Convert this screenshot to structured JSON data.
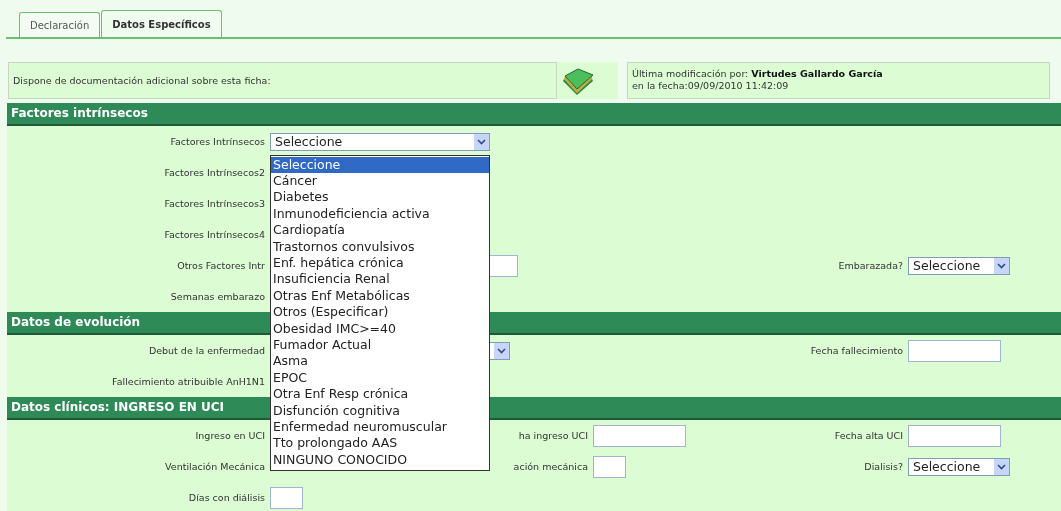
{
  "tabs": [
    {
      "label": "Declaración",
      "selected": false
    },
    {
      "label": "Datos Específicos",
      "selected": true
    }
  ],
  "info": {
    "documentation_label": "Dispone de documentación adicional sobre esta ficha:",
    "modified_by": "Última modificación por: **Virtudes Gallardo García**",
    "modified_date": "en la fecha:09/09/2010 11:42:09"
  },
  "sections": [
    {
      "title": "Factores intrínsecos",
      "rows": [
        {
          "left": {
            "label": "Factores Intrínsecos",
            "kind": "open-select",
            "value": "Seleccione",
            "options": [
              {
                "label": "Seleccione",
                "selected": true
              },
              {
                "label": "Cáncer",
                "selected": false
              },
              {
                "label": "Diabetes",
                "selected": false
              },
              {
                "label": "Inmunodeficiencia activa",
                "selected": false
              },
              {
                "label": "Cardiopatía",
                "selected": false
              },
              {
                "label": "Trastornos convulsivos",
                "selected": false
              },
              {
                "label": "Enf. hepática crónica",
                "selected": false
              },
              {
                "label": "Insuficiencia Renal",
                "selected": false
              },
              {
                "label": "Otras Enf Metabólicas",
                "selected": false
              },
              {
                "label": "Otros (Especificar)",
                "selected": false
              },
              {
                "label": "Obesidad IMC>=40",
                "selected": false
              },
              {
                "label": "Fumador Actual",
                "selected": false
              },
              {
                "label": "Asma",
                "selected": false
              },
              {
                "label": "EPOC",
                "selected": false
              },
              {
                "label": "Otra Enf Resp crónica",
                "selected": false
              },
              {
                "label": "Disfunción cognitiva",
                "selected": false
              },
              {
                "label": "Enfermedad neuromuscular",
                "selected": false
              },
              {
                "label": "Tto prolongado AAS",
                "selected": false
              },
              {
                "label": "NINGUNO CONOCIDO",
                "selected": false
              }
            ]
          }
        },
        {
          "left": {
            "label": "Factores Intrínsecos2",
            "kind": "label"
          }
        },
        {
          "left": {
            "label": "Factores Intrínsecos3",
            "kind": "label"
          }
        },
        {
          "left": {
            "label": "Factores Intrínsecos4",
            "kind": "label"
          }
        },
        {
          "left": {
            "label": "Otros Factores Intr",
            "kind": "text"
          },
          "right": {
            "label": "Embarazada?",
            "kind": "select",
            "value": "Seleccione"
          }
        },
        {
          "left": {
            "label": "Semanas embarazo",
            "kind": "label"
          }
        }
      ]
    },
    {
      "title": "Datos de evolución",
      "rows": [
        {
          "left": {
            "label": "Debut de la enfermedad",
            "kind": "select"
          },
          "right": {
            "label": "Fecha fallecimiento",
            "kind": "text"
          }
        },
        {
          "left": {
            "label": "Fallecimiento atribuible AnH1N1",
            "kind": "label"
          }
        }
      ]
    },
    {
      "title": "Datos clínicos: INGRESO EN UCI",
      "rows": [
        {
          "left": {
            "label": "Ingreso en UCI",
            "kind": "label"
          },
          "middle": {
            "label": "ha ingreso UCI",
            "kind": "text"
          },
          "right": {
            "label": "Fecha alta UCI",
            "kind": "text"
          }
        },
        {
          "left": {
            "label": "Ventilación Mecánica",
            "kind": "label"
          },
          "middle": {
            "label": "ación mecánica",
            "kind": "short-text"
          },
          "right": {
            "label": "Dialisis?",
            "kind": "select",
            "value": "Seleccione"
          }
        },
        {
          "left": {
            "label": "Días con diálisis",
            "kind": "short-text"
          }
        }
      ]
    }
  ]
}
